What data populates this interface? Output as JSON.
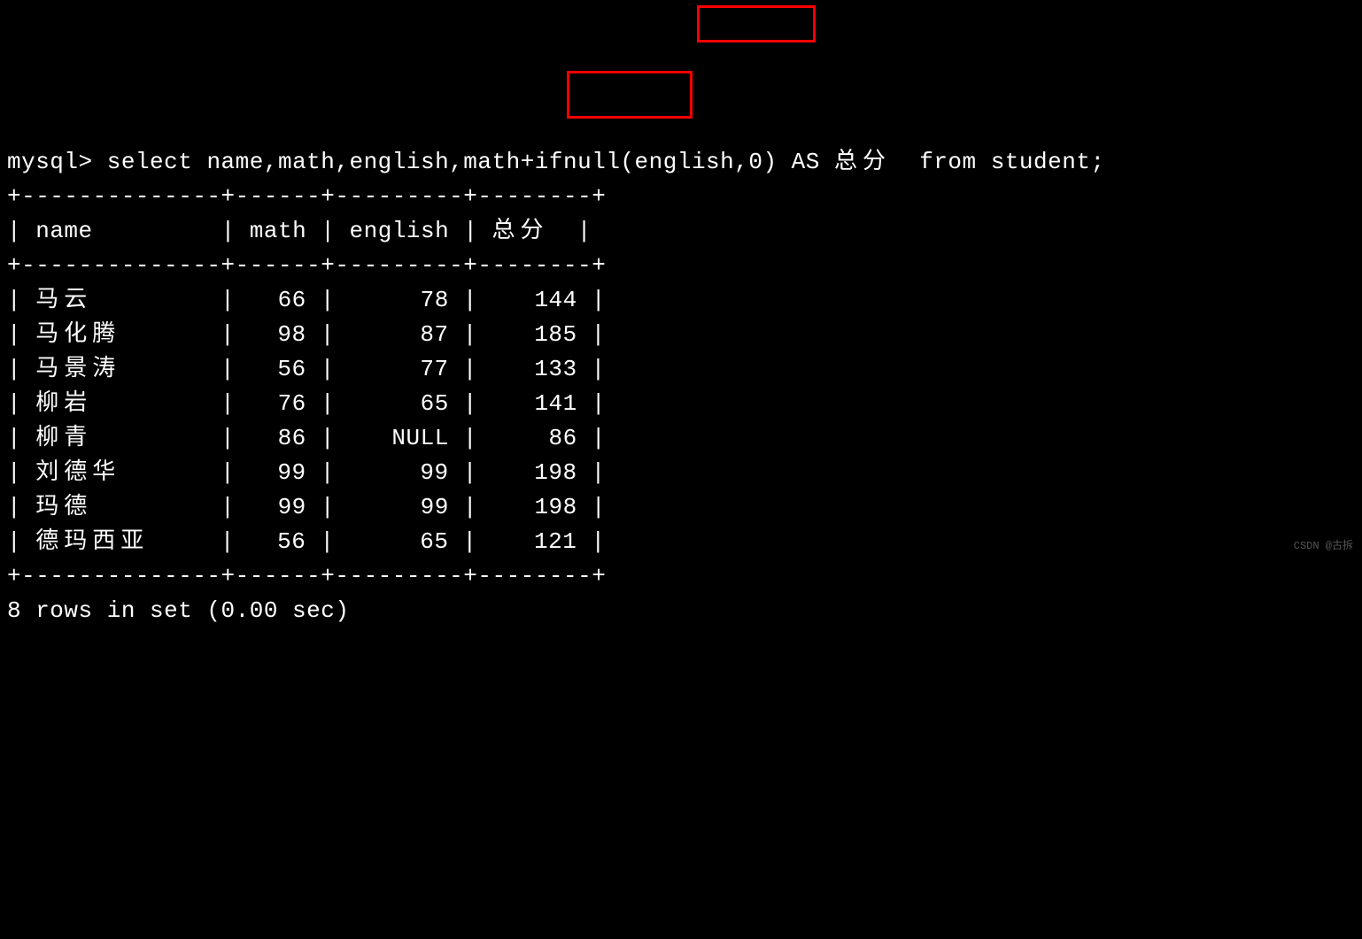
{
  "prompt": "mysql>",
  "query_parts": {
    "before": "select name,math,english,math+ifnull(english,0)",
    "highlight": "AS 总分",
    "after": "from student;"
  },
  "border_top": "+--------------+------+---------+--------+",
  "border_mid": "+--------------+------+---------+--------+",
  "border_bottom": "+--------------+------+---------+--------+",
  "headers": {
    "name": "name",
    "math": "math",
    "english": "english",
    "total": "总分"
  },
  "rows": [
    {
      "name": "马云",
      "pad": "        ",
      "math": "66",
      "english": "   78",
      "total": " 144"
    },
    {
      "name": "马化腾",
      "pad": "      ",
      "math": "98",
      "english": "   87",
      "total": " 185"
    },
    {
      "name": "马景涛",
      "pad": "      ",
      "math": "56",
      "english": "   77",
      "total": " 133"
    },
    {
      "name": "柳岩",
      "pad": "        ",
      "math": "76",
      "english": "   65",
      "total": " 141"
    },
    {
      "name": "柳青",
      "pad": "        ",
      "math": "86",
      "english": " NULL",
      "total": "  86"
    },
    {
      "name": "刘德华",
      "pad": "      ",
      "math": "99",
      "english": "   99",
      "total": " 198"
    },
    {
      "name": "玛德",
      "pad": "        ",
      "math": "99",
      "english": "   99",
      "total": " 198"
    },
    {
      "name": "德玛西亚",
      "pad": "    ",
      "math": "56",
      "english": "   65",
      "total": " 121"
    }
  ],
  "footer": "8 rows in set (0.00 sec)",
  "watermark": "CSDN @古拆",
  "chart_data": {
    "type": "table",
    "title": "select name,math,english,math+ifnull(english,0) AS 总分 from student",
    "columns": [
      "name",
      "math",
      "english",
      "总分"
    ],
    "data": [
      {
        "name": "马云",
        "math": 66,
        "english": 78,
        "总分": 144
      },
      {
        "name": "马化腾",
        "math": 98,
        "english": 87,
        "总分": 185
      },
      {
        "name": "马景涛",
        "math": 56,
        "english": 77,
        "总分": 133
      },
      {
        "name": "柳岩",
        "math": 76,
        "english": 65,
        "总分": 141
      },
      {
        "name": "柳青",
        "math": 86,
        "english": null,
        "总分": 86
      },
      {
        "name": "刘德华",
        "math": 99,
        "english": 99,
        "总分": 198
      },
      {
        "name": "玛德",
        "math": 99,
        "english": 99,
        "总分": 198
      },
      {
        "name": "德玛西亚",
        "math": 56,
        "english": 65,
        "总分": 121
      }
    ],
    "row_count": 8,
    "elapsed_sec": 0.0
  }
}
